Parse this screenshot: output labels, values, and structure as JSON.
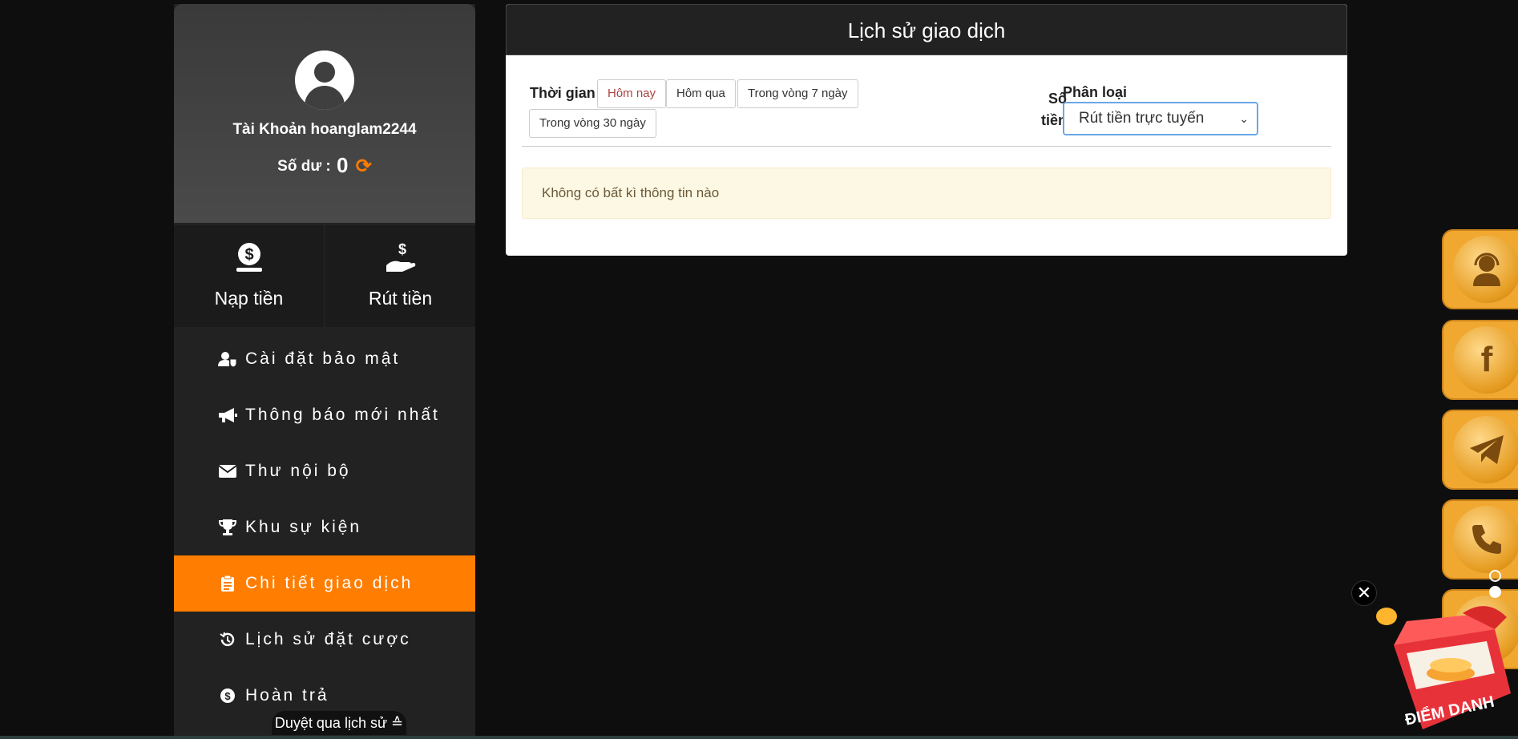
{
  "sidebar": {
    "account_label": "Tài Khoản hoanglam2244",
    "balance_label": "Số dư :",
    "balance_value": "0",
    "actions": [
      {
        "label": "Nạp tiền",
        "icon": "deposit-icon"
      },
      {
        "label": "Rút tiền",
        "icon": "withdraw-icon"
      }
    ],
    "menu": [
      {
        "label": "Cài đặt bảo mật",
        "icon": "user-shield-icon"
      },
      {
        "label": "Thông báo mới nhất",
        "icon": "megaphone-icon"
      },
      {
        "label": "Thư nội bộ",
        "icon": "envelope-icon"
      },
      {
        "label": "Khu sự kiện",
        "icon": "trophy-icon"
      },
      {
        "label": "Chi tiết giao dịch",
        "icon": "clipboard-icon",
        "active": true
      },
      {
        "label": "Lịch sử đặt cược",
        "icon": "history-icon"
      },
      {
        "label": "Hoàn trả",
        "icon": "dollar-circle-icon"
      }
    ],
    "browse_history": "Duyệt qua lịch sử ≙"
  },
  "main": {
    "title": "Lịch sử giao dịch",
    "time_filter_label": "Thời gian",
    "time_filters": [
      "Hôm nay",
      "Hôm qua",
      "Trong vòng 7 ngày",
      "Trong vòng 30 ngày"
    ],
    "active_time_filter": "Hôm nay",
    "amount_label_1": "Số",
    "amount_label_2": "tiền",
    "category_label": "Phân loại",
    "category_selected": "Rút tiền trực tuyến",
    "empty_message": "Không có bất kì thông tin nào"
  },
  "floating": {
    "buttons": [
      "headset-icon",
      "facebook-icon",
      "telegram-icon",
      "phone-icon",
      "gift-icon"
    ],
    "checkin_label": "ĐIỂM DANH",
    "close": "✕"
  },
  "colors": {
    "accent": "#ff7d00",
    "sidebar_bg": "#222222",
    "page_bg": "#0e0e0e",
    "alert_bg": "#fcf8e3",
    "float_gold": "#f0a830"
  }
}
